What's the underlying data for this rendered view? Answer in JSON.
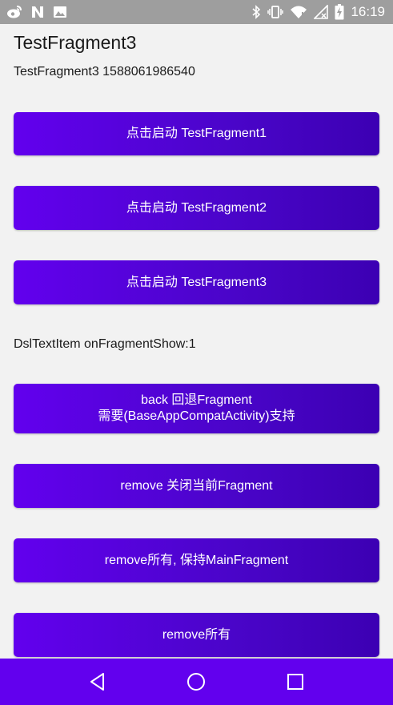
{
  "status_bar": {
    "time": "16:19",
    "left_icons": [
      "weibo-icon",
      "n-icon",
      "image-icon"
    ],
    "right_icons": [
      "bluetooth-icon",
      "vibrate-icon",
      "wifi-icon",
      "no-signal-icon",
      "battery-charging-icon"
    ]
  },
  "page": {
    "title": "TestFragment3",
    "subtitle": "TestFragment3 1588061986540",
    "show_text": "DslTextItem onFragmentShow:1"
  },
  "buttons": {
    "start1": "点击启动 TestFragment1",
    "start2": "点击启动 TestFragment2",
    "start3": "点击启动 TestFragment3",
    "back_line1": "back 回退Fragment",
    "back_line2": "需要(BaseAppCompatActivity)支持",
    "remove_current": "remove 关闭当前Fragment",
    "remove_all_keep_main": "remove所有, 保持MainFragment",
    "remove_all": "remove所有"
  },
  "nav_bar": {
    "items": [
      "back-icon",
      "home-icon",
      "recents-icon"
    ]
  },
  "colors": {
    "accent": "#6200ee",
    "status_bar": "#9e9e9e",
    "background": "#f2f2f2"
  }
}
